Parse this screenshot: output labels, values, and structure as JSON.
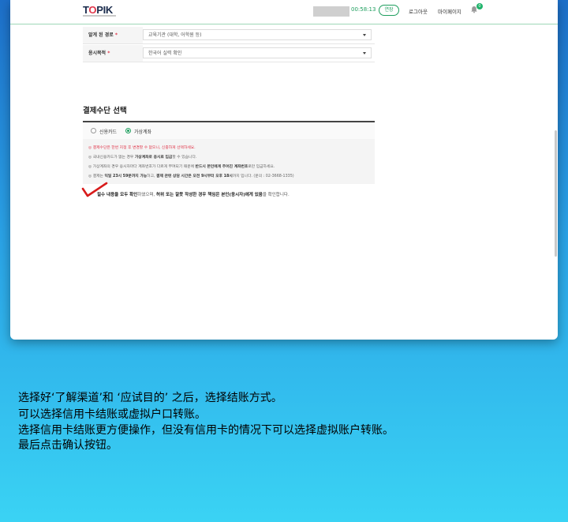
{
  "header": {
    "logo": "TOPIK",
    "timer": "00:58:13",
    "extend_label": "연장",
    "logout_label": "로그아웃",
    "mypage_label": "마이페이지",
    "notification_count": "0"
  },
  "form": {
    "rows": [
      {
        "label": "알게 된 경로",
        "required": "*",
        "value": "교육기관 (대학, 어학원 등)"
      },
      {
        "label": "응시목적",
        "required": "*",
        "value": "한국어 실력 확인"
      }
    ]
  },
  "payment": {
    "title": "결제수단 선택",
    "options": [
      {
        "label": "신용카드",
        "selected": false
      },
      {
        "label": "가상계좌",
        "selected": true
      }
    ],
    "notes": [
      "◎ 결제수단은 한번 지정 후 변경할 수 없으니, 신중하게 선택하세요.",
      "◎ 국내신용카드가 없는 경우 ",
      "가상계좌로 응시료 입금",
      "할 수 있습니다.",
      "◎ 가상계좌의 경우 응시자마다 계좌번호가 다르게 부여되기 때문에 ",
      "반드시 본인에게 주어진 계좌번호",
      "로만 입금하세요.",
      "◎ 결제는 ",
      "익일 23시 59분까지 가능",
      "하고, ",
      "결제 관련 상담 시간은 오전 9시부터 오후 18시",
      "까지 입니다. (문의 : 02-3668-1335)"
    ],
    "confirm": {
      "bold1": "필수 내용을 모두 확인",
      "t1": "하였으며, ",
      "bold2": "허위 또는 잘못 작성한 경우 책임은 본인(응시자)에게 있음",
      "t2": "을 확인합니다."
    }
  },
  "instructions": [
    "选择好‘了解渠道’和 ‘应试目的’ 之后，选择结账方式。",
    "可以选择信用卡结账或虚拟户口转账。",
    "选择信用卡结账更方便操作，但没有信用卡的情况下可以选择虚拟账户转账。",
    "最后点击确认按钮。"
  ],
  "colors": {
    "accent": "#1e9e5e",
    "warning": "#e0364a",
    "annotation": "#d81b1b"
  }
}
